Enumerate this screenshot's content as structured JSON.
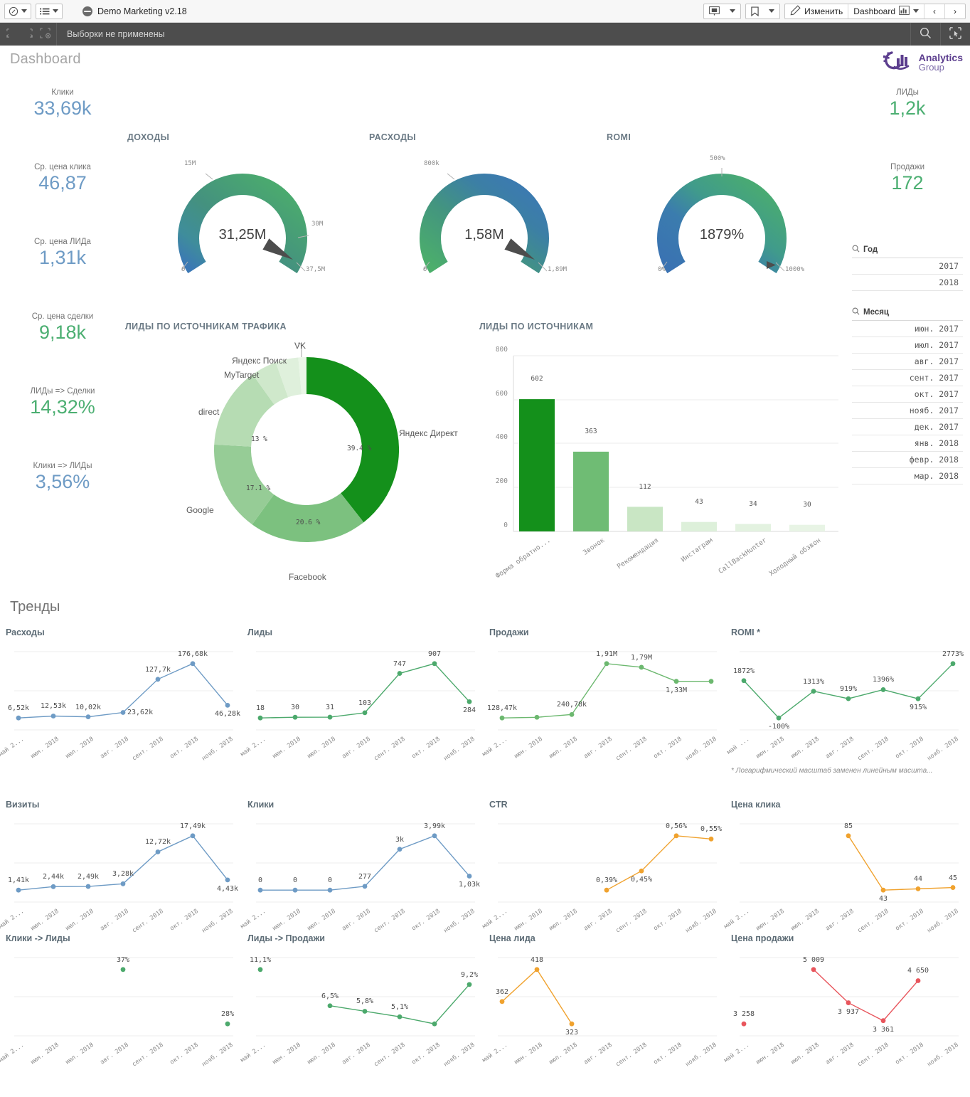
{
  "toolbar": {
    "app_title": "Demo Marketing v2.18",
    "edit_label": "Изменить",
    "sheet_label": "Dashboard",
    "nav_prev": "‹",
    "nav_next": "›"
  },
  "selection_bar": {
    "text": "Выборки не применены"
  },
  "sheet": {
    "title": "Dashboard",
    "logo_line1": "Analytics",
    "logo_line2": "Group"
  },
  "left_kpis": [
    {
      "label": "Клики",
      "value": "33,69k",
      "color": "blue"
    },
    {
      "label": "Ср. цена клика",
      "value": "46,87",
      "color": "blue"
    },
    {
      "label": "Ср. цена ЛИДа",
      "value": "1,31k",
      "color": "blue"
    },
    {
      "label": "Ср. цена сделки",
      "value": "9,18k",
      "color": "green"
    },
    {
      "label": "ЛИДы => Сделки",
      "value": "14,32%",
      "color": "green"
    },
    {
      "label": "Клики => ЛИДы",
      "value": "3,56%",
      "color": "blue"
    }
  ],
  "right_kpis": [
    {
      "label": "ЛИДы",
      "value": "1,2k",
      "color": "green"
    },
    {
      "label": "Продажи",
      "value": "172",
      "color": "green"
    }
  ],
  "gauges": [
    {
      "title": "ДОХОДЫ",
      "value": "31,25M",
      "min": "0",
      "mid": "15M",
      "max": "37,5M",
      "right_tick": "30M",
      "pct": 0.833
    },
    {
      "title": "РАСХОДЫ",
      "value": "1,58M",
      "min": "0",
      "mid": "800k",
      "max": "1,89M",
      "right_tick": "",
      "pct": 0.836
    },
    {
      "title": "ROMI",
      "value": "1879%",
      "min": "0%",
      "mid": "500%",
      "max": "1000%",
      "right_tick": "",
      "pct": 1.0
    }
  ],
  "filters": [
    {
      "title": "Год",
      "items": [
        "2017",
        "2018"
      ]
    },
    {
      "title": "Месяц",
      "items": [
        "июн. 2017",
        "июл. 2017",
        "авг. 2017",
        "сент. 2017",
        "окт. 2017",
        "нояб. 2017",
        "дек. 2017",
        "янв. 2018",
        "февр. 2018",
        "мар. 2018"
      ]
    }
  ],
  "trends_section_title": "Тренды",
  "chart_data": [
    {
      "id": "donut",
      "type": "pie",
      "title": "ЛИДЫ ПО ИСТОЧНИКАМ ТРАФИКА",
      "categories": [
        "Яндекс Директ",
        "Facebook",
        "Google",
        "direct",
        "MyTarget",
        "Яндекс Поиск",
        "VK"
      ],
      "values": [
        39.4,
        20.6,
        17.1,
        13.0,
        4.5,
        4.0,
        1.4
      ],
      "labels": [
        "39.4 %",
        "20.6 %",
        "17.1 %",
        "13 %",
        "",
        "",
        ""
      ],
      "colors": [
        "#14901b",
        "#7cc17f",
        "#96cc96",
        "#b6dcb3",
        "#cfe8cb",
        "#dff0dc",
        "#eaf6e7"
      ],
      "legend": "around"
    },
    {
      "id": "leads-by-source",
      "type": "bar",
      "title": "ЛИДЫ ПО ИСТОЧНИКАМ",
      "categories": [
        "Форма обратно...",
        "Звонок",
        "Рекомендация",
        "Инстаграм",
        "CallBackHunter",
        "Холодный обзвон"
      ],
      "values": [
        602,
        363,
        112,
        43,
        34,
        30
      ],
      "colors": [
        "#14901b",
        "#6fbc74",
        "#c9e6c4",
        "#ddf0da",
        "#e3f2e0",
        "#e8f4e5"
      ],
      "yticks": [
        0,
        200,
        400,
        600,
        800
      ],
      "ylim": [
        0,
        800
      ],
      "grid": true
    },
    {
      "id": "trend-rashody",
      "type": "line",
      "title": "Расходы",
      "color": "#6e9bc5",
      "x": [
        "май 2...",
        "июн. 2018",
        "июл. 2018",
        "авг. 2018",
        "сент. 2018",
        "окт. 2018",
        "нояб. 2018"
      ],
      "values": [
        6520,
        12530,
        10020,
        23620,
        127700,
        176680,
        46280
      ],
      "labels": [
        "6,52k",
        "12,53k",
        "10,02k",
        "23,62k",
        "127,7k",
        "176,68k",
        "46,28k"
      ],
      "label_pos": [
        "above",
        "above",
        "above",
        "right",
        "above",
        "above",
        "below"
      ]
    },
    {
      "id": "trend-lidy",
      "type": "line",
      "title": "Лиды",
      "color": "#4ca96c",
      "x": [
        "май 2...",
        "июн. 2018",
        "июл. 2018",
        "авг. 2018",
        "сент. 2018",
        "окт. 2018",
        "нояб. 2018"
      ],
      "values": [
        18,
        30,
        31,
        103,
        747,
        907,
        284
      ],
      "labels": [
        "18",
        "30",
        "31",
        "103",
        "747",
        "907",
        "284"
      ],
      "label_pos": [
        "above",
        "above",
        "above",
        "above",
        "above",
        "above",
        "below"
      ]
    },
    {
      "id": "trend-prodazhi",
      "type": "line",
      "title": "Продажи",
      "color": "#6cb86f",
      "x": [
        "май 2...",
        "июн. 2018",
        "июл. 2018",
        "авг. 2018",
        "сент. 2018",
        "окт. 2018",
        "нояб. 2018"
      ],
      "values": [
        128470,
        150000,
        240780,
        1910000,
        1790000,
        1330000,
        1330000
      ],
      "labels": [
        "128,47k",
        "",
        "240,78k",
        "1,91M",
        "1,79M",
        "1,33M",
        ""
      ],
      "label_pos": [
        "above",
        "above",
        "above",
        "above",
        "above",
        "below",
        "above"
      ]
    },
    {
      "id": "trend-romi",
      "type": "line",
      "title": "ROMI *",
      "color": "#4ca96c",
      "x": [
        "май ...",
        "июн. 2018",
        "июл. 2018",
        "авг. 2018",
        "сент. 2018",
        "окт. 2018",
        "нояб. 2018"
      ],
      "values": [
        1872,
        -100,
        1313,
        919,
        1396,
        915,
        2773
      ],
      "labels": [
        "1872%",
        "-100%",
        "1313%",
        "919%",
        "1396%",
        "915%",
        "2773%"
      ],
      "label_pos": [
        "above",
        "below",
        "above",
        "above",
        "above",
        "below",
        "above"
      ],
      "footnote": "* Логарифмический масштаб заменен линейным масшта..."
    },
    {
      "id": "trend-vizity",
      "type": "line",
      "title": "Визиты",
      "color": "#6e9bc5",
      "x": [
        "май 2...",
        "июн. 2018",
        "июл. 2018",
        "авг. 2018",
        "сент. 2018",
        "окт. 2018",
        "нояб. 2018"
      ],
      "values": [
        1410,
        2440,
        2490,
        3280,
        12720,
        17490,
        4430
      ],
      "labels": [
        "1,41k",
        "2,44k",
        "2,49k",
        "3,28k",
        "12,72k",
        "17,49k",
        "4,43k"
      ],
      "label_pos": [
        "above",
        "above",
        "above",
        "above",
        "above",
        "above",
        "below"
      ]
    },
    {
      "id": "trend-kliki",
      "type": "line",
      "title": "Клики",
      "color": "#6e9bc5",
      "x": [
        "май 2...",
        "июн. 2018",
        "июл. 2018",
        "авг. 2018",
        "сент. 2018",
        "окт. 2018",
        "нояб. 2018"
      ],
      "values": [
        0,
        0,
        0,
        277,
        3000,
        3990,
        1030
      ],
      "labels": [
        "0",
        "0",
        "0",
        "277",
        "3k",
        "3,99k",
        "1,03k"
      ],
      "label_pos": [
        "above",
        "above",
        "above",
        "above",
        "above",
        "above",
        "below"
      ]
    },
    {
      "id": "trend-ctr",
      "type": "line",
      "title": "CTR",
      "color": "#f0a22e",
      "x": [
        "май 2...",
        "июн. 2018",
        "июл. 2018",
        "авг. 2018",
        "сент. 2018",
        "окт. 2018",
        "нояб. 2018"
      ],
      "values": [
        null,
        null,
        null,
        0.39,
        0.45,
        0.56,
        0.55
      ],
      "labels": [
        "",
        "",
        "",
        "0,39%",
        "0,45%",
        "0,56%",
        "0,55%"
      ],
      "label_pos": [
        "above",
        "above",
        "above",
        "above",
        "below",
        "above",
        "above"
      ]
    },
    {
      "id": "trend-cena-klika",
      "type": "line",
      "title": "Цена клика",
      "color": "#f0a22e",
      "x": [
        "май 2...",
        "июн. 2018",
        "июл. 2018",
        "авг. 2018",
        "сент. 2018",
        "окт. 2018",
        "нояб. 2018"
      ],
      "values": [
        null,
        null,
        null,
        85,
        43,
        44,
        45
      ],
      "labels": [
        "",
        "",
        "",
        "85",
        "43",
        "44",
        "45"
      ],
      "label_pos": [
        "above",
        "above",
        "above",
        "above",
        "below",
        "above",
        "above"
      ]
    },
    {
      "id": "trend-kliki-lidy",
      "type": "line",
      "title": "Клики -> Лиды",
      "color": "#4ca96c",
      "x": [
        "май 2...",
        "июн. 2018",
        "июл. 2018",
        "авг. 2018",
        "сент. 2018",
        "окт. 2018",
        "нояб. 2018"
      ],
      "values": [
        null,
        null,
        null,
        37,
        null,
        null,
        28
      ],
      "labels": [
        "",
        "",
        "",
        "37%",
        "",
        "",
        "28%"
      ],
      "label_pos": [
        "above",
        "above",
        "above",
        "above",
        "above",
        "above",
        "above"
      ]
    },
    {
      "id": "trend-lidy-prodazhi",
      "type": "line",
      "title": "Лиды -> Продажи",
      "color": "#4ca96c",
      "x": [
        "май 2...",
        "июн. 2018",
        "июл. 2018",
        "авг. 2018",
        "сент. 2018",
        "окт. 2018",
        "нояб. 2018"
      ],
      "values": [
        11.1,
        null,
        6.5,
        5.8,
        5.1,
        4.2,
        9.2
      ],
      "labels": [
        "11,1%",
        "",
        "6,5%",
        "5,8%",
        "5,1%",
        "",
        "9,2%"
      ],
      "label_pos": [
        "above",
        "above",
        "above",
        "above",
        "above",
        "above",
        "above"
      ]
    },
    {
      "id": "trend-cena-lida",
      "type": "line",
      "title": "Цена лида",
      "color": "#f0a22e",
      "x": [
        "май 2...",
        "июн. 2018",
        "июл. 2018",
        "авг. 2018",
        "сент. 2018",
        "окт. 2018",
        "нояб. 2018"
      ],
      "values": [
        362,
        418,
        323,
        null,
        null,
        null,
        null
      ],
      "labels": [
        "362",
        "418",
        "323",
        "",
        "",
        "",
        ""
      ],
      "label_pos": [
        "above",
        "above",
        "below",
        "above",
        "above",
        "above",
        "above"
      ]
    },
    {
      "id": "trend-cena-prodazhi",
      "type": "line",
      "title": "Цена продажи",
      "color": "#e8555c",
      "x": [
        "май 2...",
        "июн. 2018",
        "июл. 2018",
        "авг. 2018",
        "сент. 2018",
        "окт. 2018",
        "нояб. 2018"
      ],
      "values": [
        3258,
        null,
        5009,
        3937,
        3361,
        4650,
        null
      ],
      "labels": [
        "3 258",
        "",
        "5 009",
        "3 937",
        "3 361",
        "4 650",
        ""
      ],
      "label_pos": [
        "above",
        "above",
        "above",
        "below",
        "below",
        "above",
        "above"
      ]
    }
  ]
}
